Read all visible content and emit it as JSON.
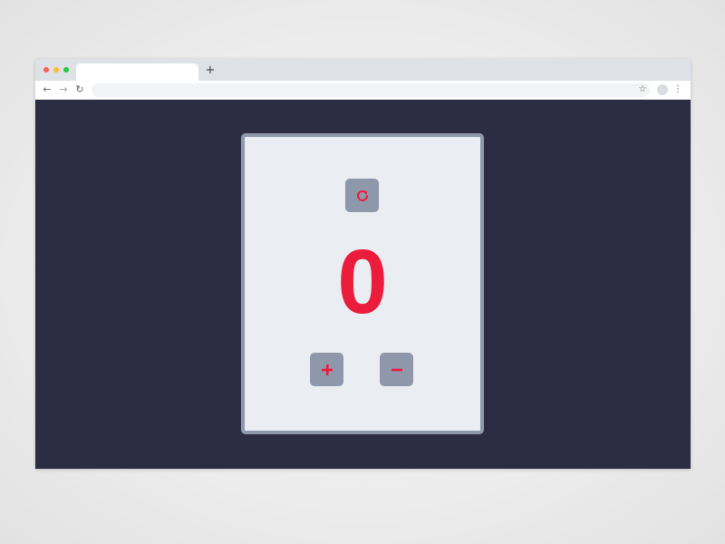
{
  "browser": {
    "tab_title": "",
    "new_tab_icon": "+",
    "url": "",
    "icons": {
      "back": "arrow-left-icon",
      "forward": "arrow-right-icon",
      "reload": "reload-icon",
      "bookmark": "star-icon",
      "profile": "avatar",
      "menu": "kebab-menu-icon"
    }
  },
  "counter": {
    "value": "0",
    "reset_icon": "refresh-icon",
    "increment_label": "+",
    "decrement_label": "−"
  },
  "colors": {
    "page_background": "#2c2c44",
    "card_background": "#eaedf2",
    "card_border": "#8f98ab",
    "button_background": "#8f98ab",
    "accent": "#ec1c3c"
  }
}
